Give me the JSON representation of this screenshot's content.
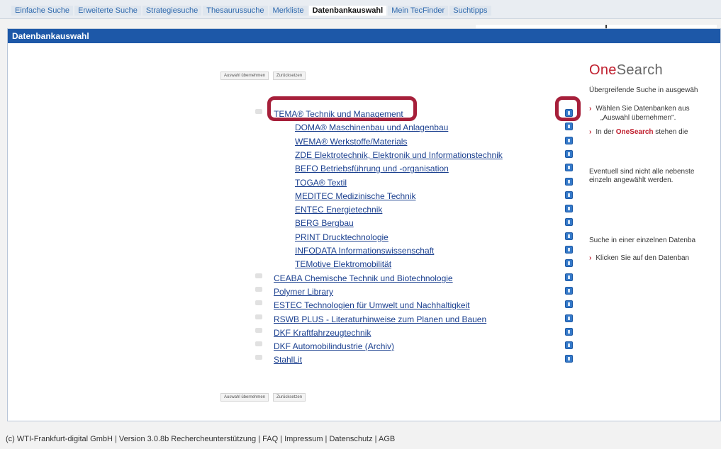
{
  "nav": {
    "tabs": [
      {
        "label": "Einfache Suche"
      },
      {
        "label": "Erweiterte Suche"
      },
      {
        "label": "Strategiesuche"
      },
      {
        "label": "Thesaurussuche"
      },
      {
        "label": "Merkliste"
      },
      {
        "label": "Datenbankauswahl",
        "active": true
      },
      {
        "label": "Mein TecFinder"
      },
      {
        "label": "Suchtipps"
      }
    ]
  },
  "panel": {
    "title": "Datenbankauswahl",
    "buttons": {
      "apply": "Auswahl übernehmen",
      "reset": "Zurücksetzen"
    }
  },
  "databases": [
    {
      "label": "TEMA® Technik und Management",
      "level": 0,
      "highlighted": true
    },
    {
      "label": "DOMA® Maschinenbau und Anlagenbau",
      "level": 1
    },
    {
      "label": "WEMA® Werkstoffe/Materials",
      "level": 1
    },
    {
      "label": "ZDE Elektrotechnik, Elektronik und Informationstechnik",
      "level": 1
    },
    {
      "label": "BEFO Betriebsführung und -organisation",
      "level": 1
    },
    {
      "label": "TOGA® Textil",
      "level": 1
    },
    {
      "label": "MEDITEC Medizinische Technik",
      "level": 1
    },
    {
      "label": "ENTEC Energietechnik",
      "level": 1
    },
    {
      "label": "BERG Bergbau",
      "level": 1
    },
    {
      "label": "PRINT Drucktechnologie",
      "level": 1
    },
    {
      "label": "INFODATA Informationswissenschaft",
      "level": 1
    },
    {
      "label": "TEMotive Elektromobilität",
      "level": 1
    },
    {
      "label": "CEABA Chemische Technik und Biotechnologie",
      "level": 0
    },
    {
      "label": "Polymer Library",
      "level": 0
    },
    {
      "label": "ESTEC Technologien für Umwelt und Nachhaltigkeit",
      "level": 0
    },
    {
      "label": "RSWB PLUS - Literaturhinweise zum Planen und Bauen",
      "level": 0
    },
    {
      "label": "DKF Kraftfahrzeugtechnik",
      "level": 0
    },
    {
      "label": "DKF Automobilindustrie (Archiv)",
      "level": 0
    },
    {
      "label": "StahlLit",
      "level": 0
    }
  ],
  "onesearch": {
    "logo_one": "One",
    "logo_search": "Search",
    "intro": "Übergreifende Suche in ausgewäh",
    "bullet1_line1": "Wählen Sie Datenbanken aus",
    "bullet1_line2": "„Auswahl übernehmen\".",
    "bullet2_pre": "In der ",
    "bullet2_bold": "OneSearch",
    "bullet2_post": " stehen die",
    "note_line1": "Eventuell sind nicht alle nebenste",
    "note_line2": "einzeln angewählt werden.",
    "single_title": "Suche in einer einzelnen Datenba",
    "single_bullet": "Klicken Sie auf den Datenban"
  },
  "footer": {
    "text": "(c) WTI-Frankfurt-digital GmbH | Version 3.0.8b Rechercheunterstützung | FAQ | Impressum | Datenschutz | AGB"
  },
  "colors": {
    "accent": "#1d58a8",
    "highlight": "#a61f3a",
    "brand_red": "#c0202f",
    "link": "#1a3f8f"
  }
}
